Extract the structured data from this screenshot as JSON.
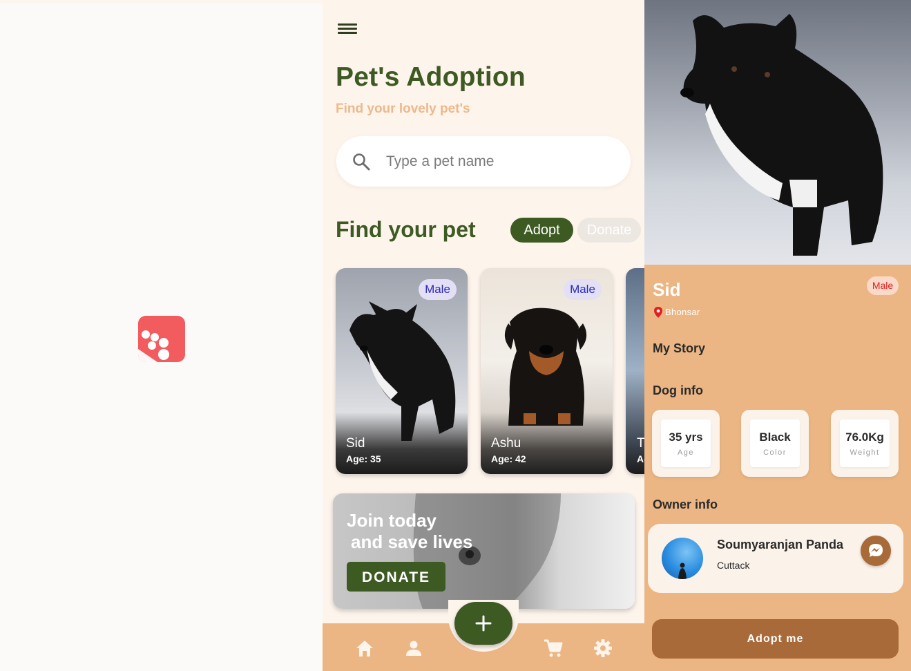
{
  "home": {
    "title": "Pet's Adoption",
    "subtitle": "Find your lovely pet's",
    "search": {
      "placeholder": "Type a pet name"
    },
    "section_title": "Find your pet",
    "filters": {
      "adopt": "Adopt",
      "donate": "Donate"
    },
    "pets": [
      {
        "name": "Sid",
        "age": "Age: 35",
        "gender": "Male"
      },
      {
        "name": "Ashu",
        "age": "Age: 42",
        "gender": "Male"
      },
      {
        "name": "T",
        "age": "Ag"
      }
    ],
    "banner": {
      "line1": "Join today",
      "line2": "and save lives",
      "button": "DONATE"
    },
    "colors": {
      "accent": "#3d5a23",
      "subtitle": "#eeb88a",
      "nav": "#ebb683"
    }
  },
  "detail": {
    "name": "Sid",
    "gender": "Male",
    "location": "Bhonsar",
    "story_heading": "My Story",
    "info_heading": "Dog info",
    "info": [
      {
        "value": "35 yrs",
        "label": "Age"
      },
      {
        "value": "Black",
        "label": "Color"
      },
      {
        "value": "76.0Kg",
        "label": "Weight"
      }
    ],
    "owner_heading": "Owner info",
    "owner": {
      "name": "Soumyaranjan Panda",
      "city": "Cuttack"
    },
    "adopt_button": "Adopt me",
    "colors": {
      "background": "#ebb683",
      "button": "#a86a38",
      "badge_text": "#e02020"
    }
  },
  "splash": {
    "logo_color": "#f25c5f"
  },
  "icons": [
    "menu-icon",
    "search-icon",
    "home-icon",
    "person-icon",
    "plus-icon",
    "cart-icon",
    "gear-icon",
    "location-pin-icon",
    "messenger-icon",
    "paw-logo-icon"
  ]
}
